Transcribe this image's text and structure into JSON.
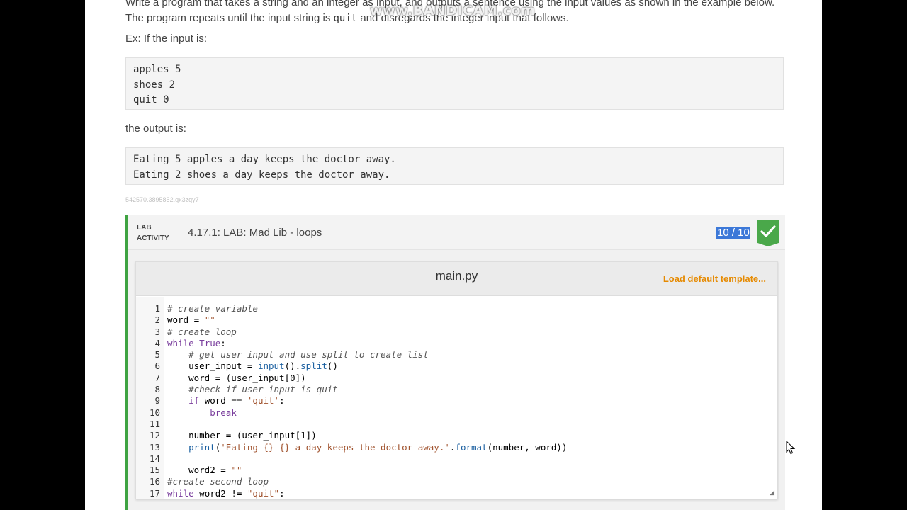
{
  "intro": {
    "line1": "Write a program that takes a string and an integer as input, and outputs a sentence using the input values as shown in the example below.",
    "line2_pre": "The program repeats until the input string is ",
    "line2_code": "quit",
    "line2_post": " and disregards the integer input that follows."
  },
  "watermark": "www.BANDICAM.com",
  "example": {
    "input_label": "Ex: If the input is:",
    "input_lines": [
      "apples 5",
      "shoes 2",
      "quit 0"
    ],
    "output_label": "the output is:",
    "output_lines": [
      "Eating 5 apples a day keeps the doctor away.",
      "Eating 2 shoes a day keeps the doctor away."
    ],
    "code_id": "542570.3895852.qx3zqy7"
  },
  "lab": {
    "tag_line1": "LAB",
    "tag_line2": "ACTIVITY",
    "title": "4.17.1: LAB: Mad Lib - loops",
    "score": "10 / 10",
    "status_icon": "check-icon",
    "accent_color": "#3fa342"
  },
  "editor": {
    "file_name": "main.py",
    "load_template": "Load default template...",
    "lines": [
      {
        "n": "1",
        "t": "# create variable"
      },
      {
        "n": "2",
        "t": "word = \"\""
      },
      {
        "n": "3",
        "t": "# create loop"
      },
      {
        "n": "4",
        "t": "while True:"
      },
      {
        "n": "5",
        "t": "    # get user input and use split to create list"
      },
      {
        "n": "6",
        "t": "    user_input = input().split()"
      },
      {
        "n": "7",
        "t": "    word = (user_input[0])"
      },
      {
        "n": "8",
        "t": "    #check if user input is quit"
      },
      {
        "n": "9",
        "t": "    if word == 'quit':"
      },
      {
        "n": "10",
        "t": "        break"
      },
      {
        "n": "11",
        "t": ""
      },
      {
        "n": "12",
        "t": "    number = (user_input[1])"
      },
      {
        "n": "13",
        "t": "    print('Eating {} {} a day keeps the doctor away.'.format(number, word))"
      },
      {
        "n": "14",
        "t": ""
      },
      {
        "n": "15",
        "t": "    word2 = \"\""
      },
      {
        "n": "16",
        "t": "#create second loop"
      },
      {
        "n": "17",
        "t": "while word2 != \"quit\":"
      }
    ]
  }
}
